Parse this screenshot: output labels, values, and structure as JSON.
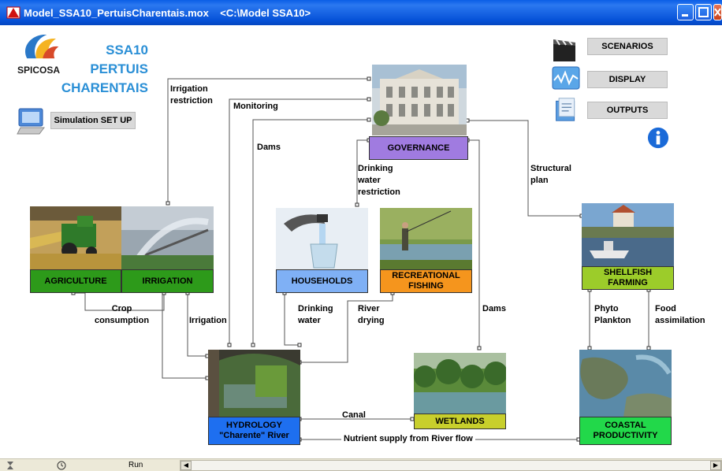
{
  "window": {
    "title": "Model_SSA10_PertuisCharentais.mox    <C:\\Model SSA10>"
  },
  "brand": {
    "logo_text": "SPICOSA",
    "line1": "SSA10",
    "line2": "PERTUIS",
    "line3": "CHARENTAIS"
  },
  "buttons": {
    "simulation_setup": "Simulation SET UP",
    "scenarios": "SCENARIOS",
    "display": "DISPLAY",
    "outputs": "OUTPUTS"
  },
  "nodes": {
    "agriculture": "AGRICULTURE",
    "irrigation": "IRRIGATION",
    "households": "HOUSEHOLDS",
    "recreational_fishing": "RECREATIONAL\nFISHING",
    "governance": "GOVERNANCE",
    "shellfish_farming": "SHELLFISH\nFARMING",
    "hydrology": "HYDROLOGY\n\"Charente\" River",
    "wetlands": "WETLANDS",
    "coastal_productivity": "COASTAL\nPRODUCTIVITY"
  },
  "edges": {
    "irrigation_restriction": "Irrigation\nrestriction",
    "monitoring": "Monitoring",
    "dams_top": "Dams",
    "drinking_water_restriction": "Drinking\nwater\nrestriction",
    "structural_plan": "Structural\nplan",
    "crop_consumption": "Crop\nconsumption",
    "irrigation": "Irrigation",
    "drinking_water": "Drinking\nwater",
    "river_drying": "River\ndrying",
    "dams_right": "Dams",
    "phyto_plankton": "Phyto\nPlankton",
    "food_assimilation": "Food\nassimilation",
    "canal": "Canal",
    "nutrient_supply": "Nutrient supply from River flow"
  },
  "colors": {
    "agriculture": "#2d9a1a",
    "irrigation": "#2d9a1a",
    "households": "#7fb0f5",
    "recreational_fishing": "#f5951d",
    "governance": "#a07be0",
    "shellfish_farming": "#9ccc2a",
    "hydrology": "#1e6ff0",
    "wetlands": "#c8cf2c",
    "coastal_productivity": "#22d84a"
  },
  "statusbar": {
    "run_label": "Run"
  }
}
